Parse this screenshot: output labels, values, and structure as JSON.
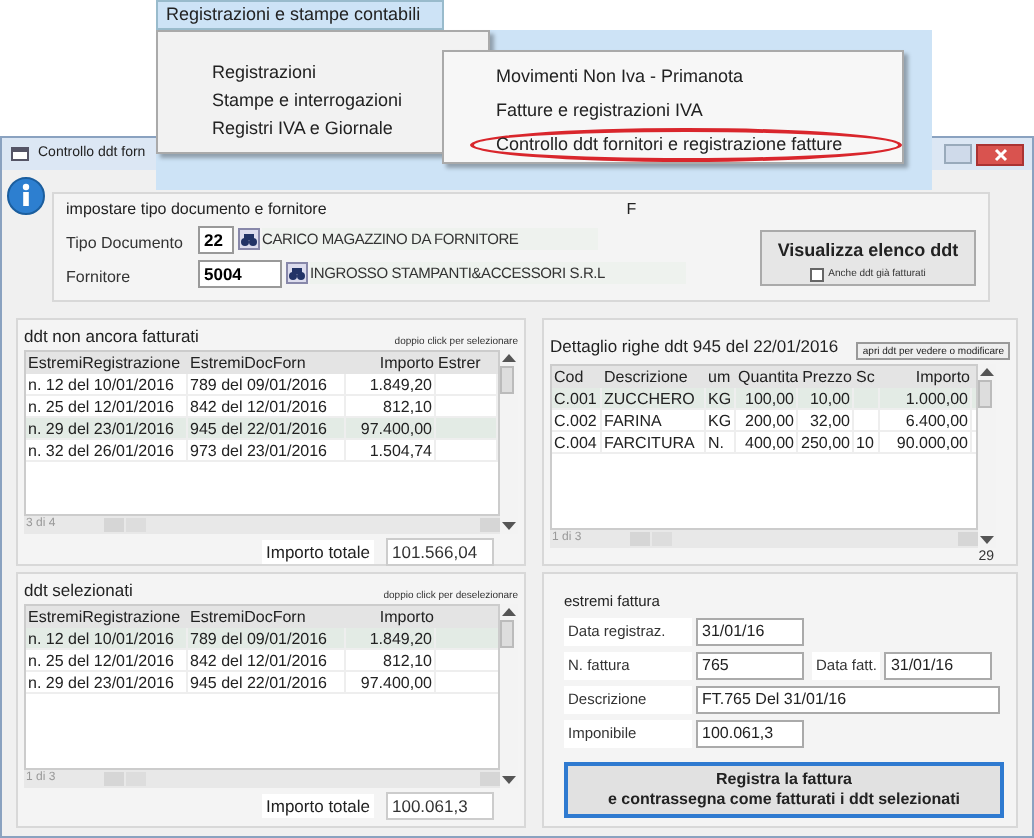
{
  "menu": {
    "title": "Registrazioni e stampe contabili",
    "items": [
      {
        "label": "Registrazioni"
      },
      {
        "label": "Stampe e interrogazioni"
      },
      {
        "label": "Registri IVA e Giornale"
      }
    ],
    "submenu": [
      {
        "label": "Movimenti Non Iva - Primanota",
        "circled": false
      },
      {
        "label": "Fatture e registrazioni IVA",
        "circled": false
      },
      {
        "label": "Controllo ddt fornitori e registrazione fatture",
        "circled": true
      }
    ]
  },
  "window": {
    "title": "Controllo ddt forn"
  },
  "header": {
    "caption": "impostare tipo documento e fornitore",
    "flag": "F",
    "fields": [
      {
        "label": "Tipo Documento",
        "value": "22",
        "description": "CARICO MAGAZZINO DA FORNITORE"
      },
      {
        "label": "Fornitore",
        "value": "5004",
        "description": "INGROSSO STAMPANTI&ACCESSORI S.R.L"
      }
    ],
    "button": "Visualizza elenco ddt",
    "checkbox": {
      "label": "Anche ddt già fatturati",
      "checked": false
    }
  },
  "pending": {
    "title": "ddt non ancora fatturati",
    "hint": "doppio click per selezionare",
    "columns": [
      {
        "label": "EstremiRegistrazione",
        "kind": "text"
      },
      {
        "label": "EstremiDocForn",
        "kind": "text"
      },
      {
        "label": "Importo",
        "kind": "number"
      },
      {
        "label": "Estrer",
        "kind": "text"
      }
    ],
    "rows": [
      {
        "cells": [
          "n. 12 del 10/01/2016",
          "789 del 09/01/2016",
          "1.849,20",
          ""
        ],
        "selected": false
      },
      {
        "cells": [
          "n. 25 del 12/01/2016",
          "842 del 12/01/2016",
          "812,10",
          ""
        ],
        "selected": false
      },
      {
        "cells": [
          "n. 29 del 23/01/2016",
          "945 del 22/01/2016",
          "97.400,00",
          ""
        ],
        "selected": true
      },
      {
        "cells": [
          "n. 32 del 26/01/2016",
          "973 del 23/01/2016",
          "1.504,74",
          ""
        ],
        "selected": false
      }
    ],
    "pager": "3 di 4",
    "total_label": "Importo totale",
    "total": "101.566,04"
  },
  "detail": {
    "title": "Dettaglio righe ddt 945 del 22/01/2016",
    "button": "apri ddt per vedere o modificare",
    "columns": [
      {
        "label": "Cod",
        "kind": "text"
      },
      {
        "label": "Descrizione",
        "kind": "text"
      },
      {
        "label": "um",
        "kind": "text"
      },
      {
        "label": "Quantita",
        "kind": "number"
      },
      {
        "label": "Prezzo",
        "kind": "number"
      },
      {
        "label": "Sc",
        "kind": "text"
      },
      {
        "label": "Importo",
        "kind": "number"
      }
    ],
    "rows": [
      {
        "cells": [
          "C.001",
          "ZUCCHERO",
          "KG",
          "100,00",
          "10,00",
          "",
          "1.000,00"
        ],
        "selected": true
      },
      {
        "cells": [
          "C.002",
          "FARINA",
          "KG",
          "200,00",
          "32,00",
          "",
          "6.400,00"
        ],
        "selected": false
      },
      {
        "cells": [
          "C.004",
          "FARCITURA",
          "N.",
          "400,00",
          "250,00",
          "10",
          "90.000,00"
        ],
        "selected": false
      }
    ],
    "pager": "1 di 3",
    "count": "29"
  },
  "chosen": {
    "title": "ddt selezionati",
    "hint": "doppio click per deselezionare",
    "columns": [
      {
        "label": "EstremiRegistrazione",
        "kind": "text"
      },
      {
        "label": "EstremiDocForn",
        "kind": "text"
      },
      {
        "label": "Importo",
        "kind": "number"
      }
    ],
    "rows": [
      {
        "cells": [
          "n. 12 del 10/01/2016",
          "789 del 09/01/2016",
          "1.849,20"
        ],
        "selected": true
      },
      {
        "cells": [
          "n. 25 del 12/01/2016",
          "842 del 12/01/2016",
          "812,10"
        ],
        "selected": false
      },
      {
        "cells": [
          "n. 29 del 23/01/2016",
          "945 del 22/01/2016",
          "97.400,00"
        ],
        "selected": false
      }
    ],
    "pager": "1 di 3",
    "total_label": "Importo totale",
    "total": "100.061,3"
  },
  "invoice": {
    "title": "estremi fattura",
    "rows": [
      [
        {
          "label": "Data registraz.",
          "value": "31/01/16",
          "kind": "short"
        }
      ],
      [
        {
          "label": "N. fattura",
          "value": "765",
          "kind": "short"
        },
        {
          "label": "Data fatt.",
          "value": "31/01/16",
          "kind": "short"
        }
      ],
      [
        {
          "label": "Descrizione",
          "value": "FT.765 Del 31/01/16",
          "kind": "wide"
        }
      ],
      [
        {
          "label": "Imponibile",
          "value": "100.061,3",
          "kind": "short"
        }
      ]
    ],
    "submit": [
      "Registra la fattura",
      "e contrassegna come fatturati i ddt selezionati"
    ]
  }
}
